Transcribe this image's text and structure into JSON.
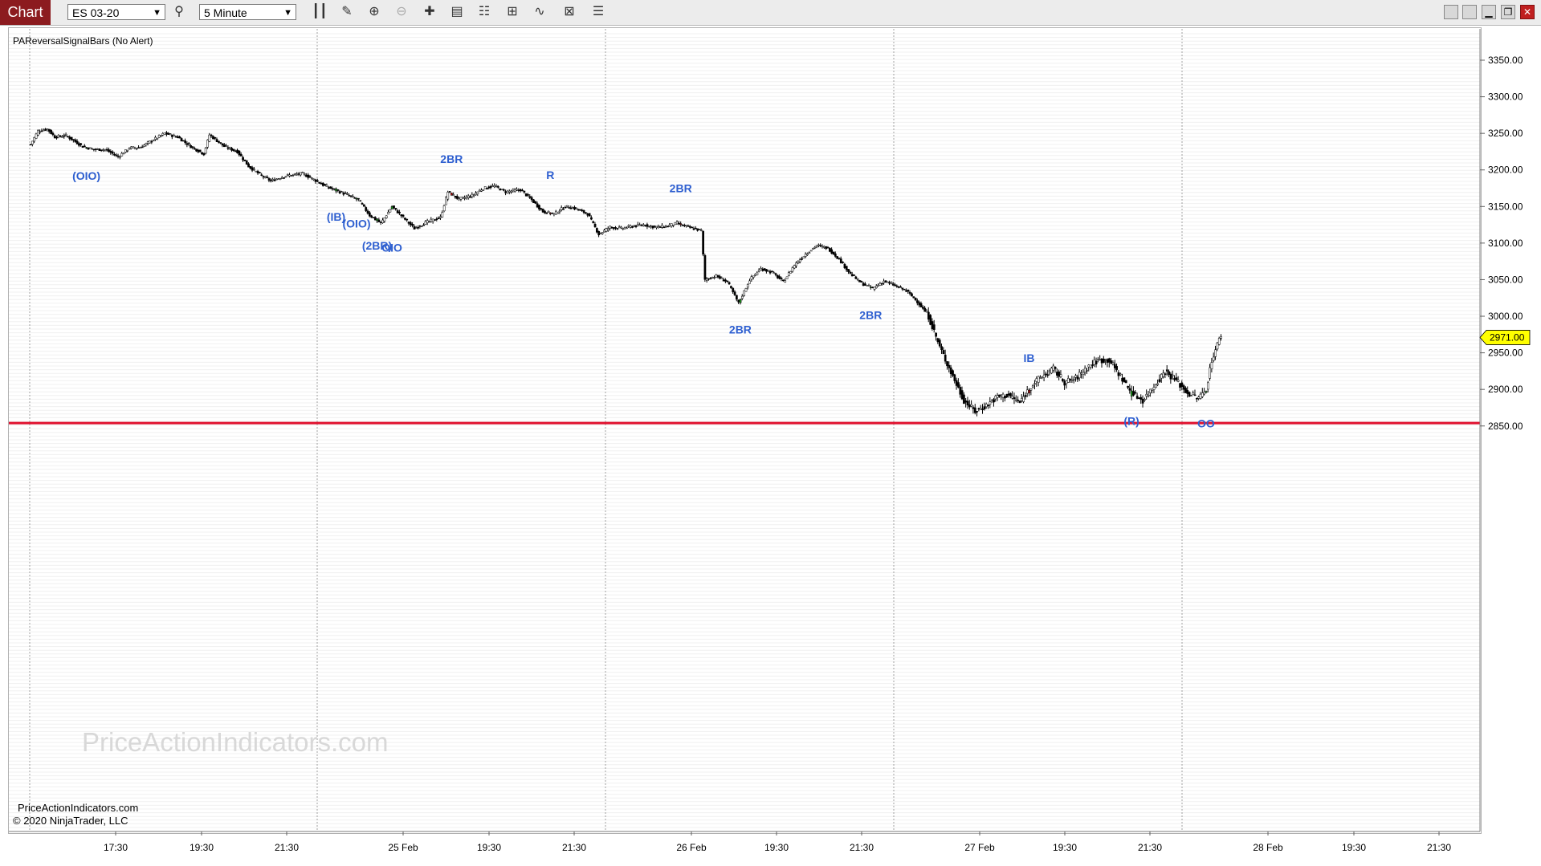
{
  "toolbar": {
    "tab_label": "Chart",
    "instrument": "ES 03-20",
    "interval": "5 Minute",
    "tools": [
      "bar-style-icon",
      "pencil-icon",
      "zoom-in-icon",
      "zoom-out-icon",
      "crosshair-icon",
      "data-box-icon",
      "properties-icon",
      "indicators-icon",
      "strategies-icon",
      "alerts-icon",
      "list-icon"
    ]
  },
  "window": {
    "buttons": [
      "restore-left-icon",
      "restore-right-icon",
      "minimize-icon",
      "maximize-icon",
      "close-icon"
    ]
  },
  "indicator_title": "PAReversalSignalBars (No Alert)",
  "watermark": "PriceActionIndicators.com",
  "footer": {
    "site": "PriceActionIndicators.com",
    "copyright": "© 2020 NinjaTrader, LLC"
  },
  "colors": {
    "up": "#1f9a1f",
    "down": "#b01010",
    "signal_text": "#2e5fd0",
    "support": "#e0102e",
    "price_tag": "#ffff00"
  },
  "chart_data": {
    "type": "candlestick",
    "instrument": "ES 03-20",
    "interval": "5 Minute",
    "ylim": [
      2840,
      3370
    ],
    "y_ticks": [
      "3350.00",
      "3300.00",
      "3250.00",
      "3200.00",
      "3150.00",
      "3100.00",
      "3050.00",
      "3000.00",
      "2950.00",
      "2900.00",
      "2850.00"
    ],
    "x_ticks": [
      "17:30",
      "19:30",
      "21:30",
      "25 Feb",
      "19:30",
      "21:30",
      "26 Feb",
      "19:30",
      "21:30",
      "27 Feb",
      "19:30",
      "21:30",
      "28 Feb",
      "19:30",
      "21:30"
    ],
    "last_price": "2971.00",
    "support_line": 2854,
    "price_anchors": [
      [
        0,
        3235
      ],
      [
        4,
        3253
      ],
      [
        9,
        3256
      ],
      [
        13,
        3245
      ],
      [
        19,
        3247
      ],
      [
        28,
        3232
      ],
      [
        34,
        3228
      ],
      [
        40,
        3228
      ],
      [
        47,
        3218
      ],
      [
        53,
        3230
      ],
      [
        59,
        3231
      ],
      [
        65,
        3240
      ],
      [
        72,
        3250
      ],
      [
        79,
        3245
      ],
      [
        86,
        3232
      ],
      [
        93,
        3222
      ],
      [
        96,
        3248
      ],
      [
        104,
        3232
      ],
      [
        111,
        3225
      ],
      [
        117,
        3205
      ],
      [
        124,
        3192
      ],
      [
        129,
        3185
      ],
      [
        137,
        3192
      ],
      [
        146,
        3195
      ],
      [
        152,
        3187
      ],
      [
        158,
        3178
      ],
      [
        164,
        3172
      ],
      [
        170,
        3166
      ],
      [
        176,
        3159
      ],
      [
        182,
        3138
      ],
      [
        188,
        3127
      ],
      [
        194,
        3150
      ],
      [
        200,
        3135
      ],
      [
        206,
        3120
      ],
      [
        212,
        3128
      ],
      [
        220,
        3135
      ],
      [
        224,
        3170
      ],
      [
        230,
        3160
      ],
      [
        237,
        3165
      ],
      [
        243,
        3175
      ],
      [
        249,
        3178
      ],
      [
        255,
        3170
      ],
      [
        263,
        3173
      ],
      [
        269,
        3159
      ],
      [
        275,
        3143
      ],
      [
        281,
        3140
      ],
      [
        287,
        3150
      ],
      [
        293,
        3147
      ],
      [
        299,
        3140
      ],
      [
        305,
        3112
      ],
      [
        311,
        3122
      ],
      [
        317,
        3120
      ],
      [
        323,
        3123
      ],
      [
        329,
        3125
      ],
      [
        335,
        3122
      ],
      [
        341,
        3123
      ],
      [
        347,
        3127
      ],
      [
        353,
        3122
      ],
      [
        360,
        3117
      ],
      [
        362,
        3050
      ],
      [
        368,
        3055
      ],
      [
        374,
        3047
      ],
      [
        380,
        3018
      ],
      [
        386,
        3050
      ],
      [
        392,
        3065
      ],
      [
        398,
        3060
      ],
      [
        404,
        3047
      ],
      [
        410,
        3070
      ],
      [
        416,
        3085
      ],
      [
        422,
        3097
      ],
      [
        428,
        3093
      ],
      [
        434,
        3078
      ],
      [
        440,
        3058
      ],
      [
        446,
        3045
      ],
      [
        452,
        3038
      ],
      [
        458,
        3048
      ],
      [
        464,
        3042
      ],
      [
        470,
        3035
      ],
      [
        476,
        3020
      ],
      [
        482,
        3000
      ],
      [
        488,
        2958
      ],
      [
        495,
        2918
      ],
      [
        501,
        2885
      ],
      [
        507,
        2870
      ],
      [
        513,
        2878
      ],
      [
        519,
        2890
      ],
      [
        525,
        2892
      ],
      [
        531,
        2882
      ],
      [
        537,
        2905
      ],
      [
        543,
        2918
      ],
      [
        549,
        2928
      ],
      [
        555,
        2910
      ],
      [
        561,
        2915
      ],
      [
        567,
        2930
      ],
      [
        573,
        2940
      ],
      [
        579,
        2940
      ],
      [
        585,
        2918
      ],
      [
        591,
        2895
      ],
      [
        597,
        2885
      ],
      [
        603,
        2905
      ],
      [
        609,
        2925
      ],
      [
        615,
        2912
      ],
      [
        621,
        2895
      ],
      [
        627,
        2888
      ],
      [
        631,
        2900
      ],
      [
        634,
        2940
      ],
      [
        639,
        2975
      ]
    ],
    "signals": [
      {
        "label": "(OIO)",
        "bar": 30,
        "type": "bull",
        "price": 3228
      },
      {
        "label": "(IB)",
        "bar": 164,
        "type": "bull",
        "price": 3172
      },
      {
        "label": "(OIO)",
        "bar": 175,
        "type": "bull",
        "price": 3163
      },
      {
        "label": "(2BR)",
        "bar": 186,
        "type": "bull",
        "price": 3133
      },
      {
        "label": "OIO",
        "bar": 194,
        "type": "bull",
        "price": 3130
      },
      {
        "label": "2BR",
        "bar": 226,
        "type": "bear",
        "price": 3170
      },
      {
        "label": "R",
        "bar": 279,
        "type": "bear",
        "price": 3148
      },
      {
        "label": "2BR",
        "bar": 349,
        "type": "bear",
        "price": 3130
      },
      {
        "label": "2BR",
        "bar": 381,
        "type": "bull",
        "price": 3018
      },
      {
        "label": "2BR",
        "bar": 451,
        "type": "bull",
        "price": 3038
      },
      {
        "label": "IB",
        "bar": 536,
        "type": "bear",
        "price": 2898
      },
      {
        "label": "(R)",
        "bar": 591,
        "type": "bull",
        "price": 2893
      },
      {
        "label": "OO",
        "bar": 631,
        "type": "bull",
        "price": 2890
      }
    ]
  }
}
